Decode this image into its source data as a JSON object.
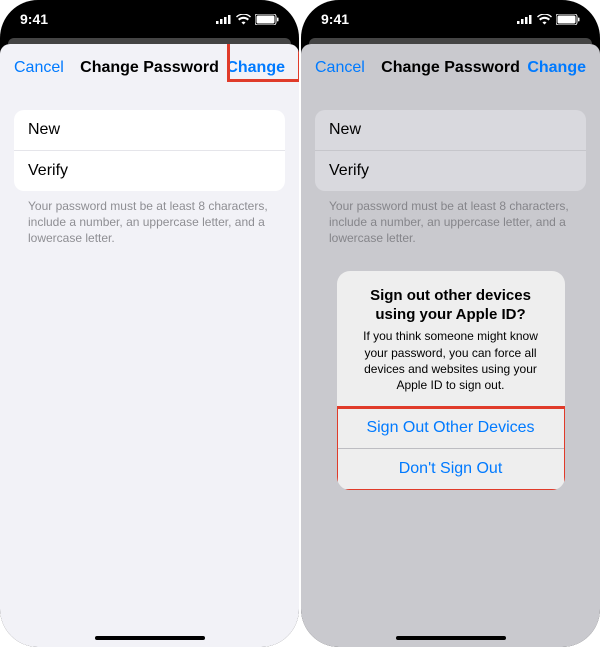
{
  "status": {
    "time": "9:41"
  },
  "screen1": {
    "nav": {
      "cancel": "Cancel",
      "title": "Change Password",
      "change": "Change"
    },
    "fields": {
      "new": "New",
      "verify": "Verify"
    },
    "hint": "Your password must be at least 8 characters, include a number, an uppercase letter, and a lowercase letter."
  },
  "screen2": {
    "nav": {
      "cancel": "Cancel",
      "title": "Change Password",
      "change": "Change"
    },
    "fields": {
      "new": "New",
      "verify": "Verify"
    },
    "hint": "Your password must be at least 8 characters, include a number, an uppercase letter, and a lowercase letter.",
    "alert": {
      "title": "Sign out other devices using your Apple ID?",
      "message": "If you think someone might know your password, you can force all devices and websites using your Apple ID to sign out.",
      "signOut": "Sign Out Other Devices",
      "dontSignOut": "Don't Sign Out"
    }
  }
}
